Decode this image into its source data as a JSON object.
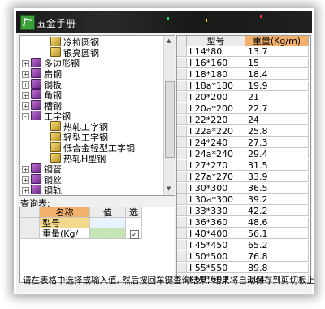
{
  "window": {
    "title": "五金手册",
    "icon": "app-icon"
  },
  "tree": {
    "items": [
      {
        "label": "冷拉圆钢",
        "icon": "book-yellow",
        "level": 2,
        "expander": ""
      },
      {
        "label": "银亮圆钢",
        "icon": "book-yellow",
        "level": 2,
        "expander": ""
      },
      {
        "label": "多边形钢",
        "icon": "book-purple",
        "level": 1,
        "expander": "+"
      },
      {
        "label": "扁钢",
        "icon": "book-purple",
        "level": 1,
        "expander": "+"
      },
      {
        "label": "钢板",
        "icon": "book-purple",
        "level": 1,
        "expander": "+"
      },
      {
        "label": "角钢",
        "icon": "book-purple",
        "level": 1,
        "expander": "+"
      },
      {
        "label": "槽钢",
        "icon": "book-purple",
        "level": 1,
        "expander": "+"
      },
      {
        "label": "工字钢",
        "icon": "book-purple",
        "level": 1,
        "expander": "-"
      },
      {
        "label": "热轧工字钢",
        "icon": "book-yellow",
        "level": 2,
        "expander": ""
      },
      {
        "label": "轻型工字钢",
        "icon": "book-yellow",
        "level": 2,
        "expander": ""
      },
      {
        "label": "低合金轻型工字钢",
        "icon": "book-yellow",
        "level": 2,
        "expander": ""
      },
      {
        "label": "热轧H型钢",
        "icon": "book-yellow",
        "level": 2,
        "expander": ""
      },
      {
        "label": "钢管",
        "icon": "book-purple",
        "level": 1,
        "expander": "+"
      },
      {
        "label": "钢丝",
        "icon": "book-purple",
        "level": 1,
        "expander": "+"
      },
      {
        "label": "钢轨",
        "icon": "book-purple",
        "level": 1,
        "expander": "+"
      }
    ]
  },
  "query": {
    "label": "查询表:",
    "headers": [
      "名称",
      "值",
      "选"
    ],
    "rows": [
      {
        "name": "型号",
        "value": "",
        "checked": false
      },
      {
        "name": "重量(Kg/",
        "value": "",
        "checked": true
      }
    ],
    "check_mark": "✓"
  },
  "results": {
    "headers": [
      "型号",
      "重量(Kg/m)"
    ],
    "rows": [
      [
        "I 14*80",
        "13.7"
      ],
      [
        "I 16*160",
        "15"
      ],
      [
        "I 18*180",
        "18.4"
      ],
      [
        "I 18a*180",
        "19.9"
      ],
      [
        "I 20*200",
        "21"
      ],
      [
        "I 20a*200",
        "22.7"
      ],
      [
        "I 22*220",
        "24"
      ],
      [
        "I 22a*220",
        "25.8"
      ],
      [
        "I 24*240",
        "27.3"
      ],
      [
        "I 24a*240",
        "29.4"
      ],
      [
        "I 27*270",
        "31.5"
      ],
      [
        "I 27a*270",
        "33.9"
      ],
      [
        "I 30*300",
        "36.5"
      ],
      [
        "I 30a*300",
        "39.2"
      ],
      [
        "I 33*330",
        "42.2"
      ],
      [
        "I 36*360",
        "48.6"
      ],
      [
        "I 40*400",
        "56.1"
      ],
      [
        "I 45*450",
        "65.2"
      ],
      [
        "I 50*500",
        "76.8"
      ],
      [
        "I 55*550",
        "89.8"
      ],
      [
        "I 60*600",
        "104"
      ]
    ]
  },
  "status": {
    "text": "请在表格中选择或输入值, 然后按回车键查询结果, 结果将自动保存到剪切板上"
  },
  "colors": {
    "header_accent": "#f2b06a",
    "selected_row": "#f4c18a",
    "query_name_cell": "#f3d98b",
    "query_value_cell": "#c6e5b6",
    "query_type_value": "#e8f2ff"
  }
}
